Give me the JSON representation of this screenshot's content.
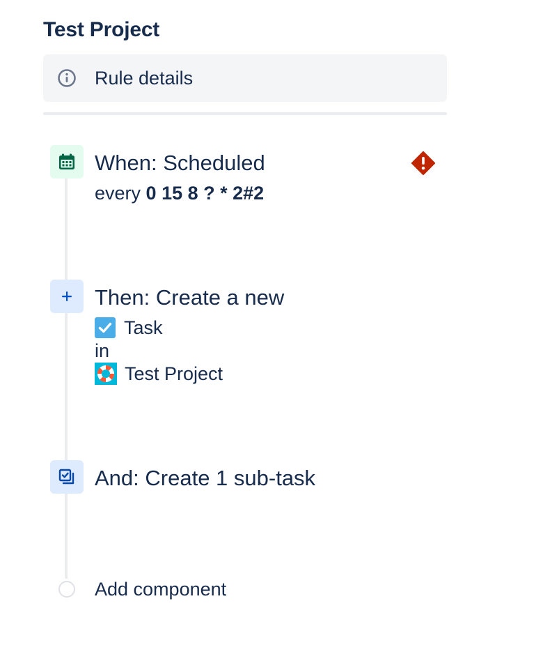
{
  "project": {
    "title": "Test Project"
  },
  "rule_details": {
    "label": "Rule details",
    "icon": "info-icon"
  },
  "trigger": {
    "title": "When: Scheduled",
    "prefix": "every",
    "cron": "0 15 8 ? * 2#2",
    "icon": "calendar-icon",
    "status_icon": "error-diamond-icon",
    "accent": "#006644",
    "icon_bg": "#e3fcef",
    "error_color": "#bf2600"
  },
  "action": {
    "title": "Then: Create a new",
    "issue_type": "Task",
    "connector": "in",
    "project": "Test Project",
    "icon": "plus-icon",
    "accent": "#0052cc",
    "icon_bg": "#deebff"
  },
  "subtask_action": {
    "title": "And: Create 1 sub-task",
    "icon": "subtask-icon"
  },
  "add_component": {
    "label": "Add component"
  }
}
